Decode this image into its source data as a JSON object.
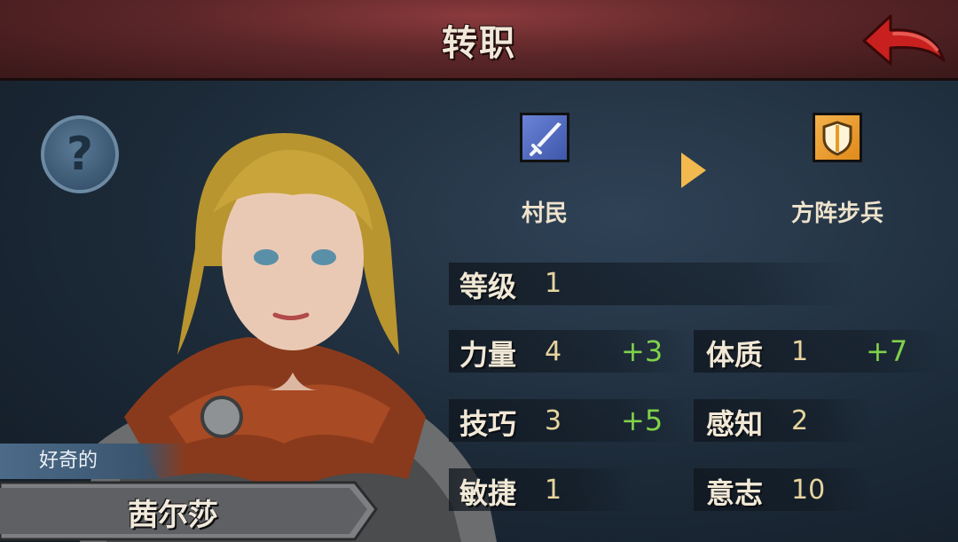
{
  "header": {
    "title": "转职"
  },
  "icons": {
    "back": "back-arrow-icon",
    "help": "question-mark-icon",
    "from_class": "sword-icon",
    "to_class": "shield-icon",
    "transition": "play-arrow-icon"
  },
  "help": {
    "glyph": "?"
  },
  "character": {
    "trait": "好奇的",
    "name": "茜尔莎"
  },
  "job_change": {
    "from_class": "村民",
    "to_class": "方阵步兵"
  },
  "stats": {
    "level": {
      "label": "等级",
      "value": "1"
    },
    "strength": {
      "label": "力量",
      "value": "4",
      "bonus": "+3"
    },
    "constitution": {
      "label": "体质",
      "value": "1",
      "bonus": "+7"
    },
    "skill": {
      "label": "技巧",
      "value": "3",
      "bonus": "+5"
    },
    "perception": {
      "label": "感知",
      "value": "2"
    },
    "agility": {
      "label": "敏捷",
      "value": "1"
    },
    "will": {
      "label": "意志",
      "value": "10"
    }
  },
  "colors": {
    "header": "#5c2629",
    "back_arrow": "#c8201e",
    "bonus": "#7fd14a",
    "value": "#e7d49e",
    "from_icon": "#4f68c4",
    "to_icon": "#f0a232"
  }
}
